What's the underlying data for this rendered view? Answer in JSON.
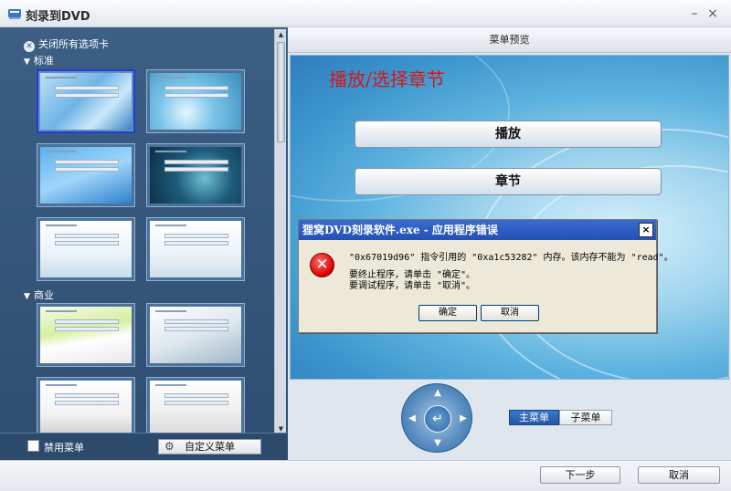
{
  "window": {
    "title": "刻录到DVD",
    "minimize": "–",
    "close": "×"
  },
  "left_panel": {
    "close_all_tabs": "关闭所有选项卡",
    "category_standard": "标准",
    "category_business": "商业",
    "disable_menu_label": "禁用菜单",
    "custom_menu_button": "自定义菜单"
  },
  "preview": {
    "header": "菜单预览",
    "menu_title": "播放/选择章节",
    "button_play": "播放",
    "button_chapters": "章节"
  },
  "navigation": {
    "main_menu_tab": "主菜单",
    "sub_menu_tab": "子菜单"
  },
  "error_dialog": {
    "title": "狸窝DVD刻录软件.exe - 应用程序错误",
    "close": "×",
    "icon_symbol": "✕",
    "message_line1": "\"0x67019d96\" 指令引用的 \"0xa1c53282\" 内存。该内存不能为 \"read\"。",
    "message_line2": "要终止程序，请单击 \"确定\"。",
    "message_line3": "要调试程序，请单击 \"取消\"。",
    "ok_button": "确定",
    "cancel_button": "取消"
  },
  "footer": {
    "next_button": "下一步",
    "cancel_button": "取消"
  }
}
